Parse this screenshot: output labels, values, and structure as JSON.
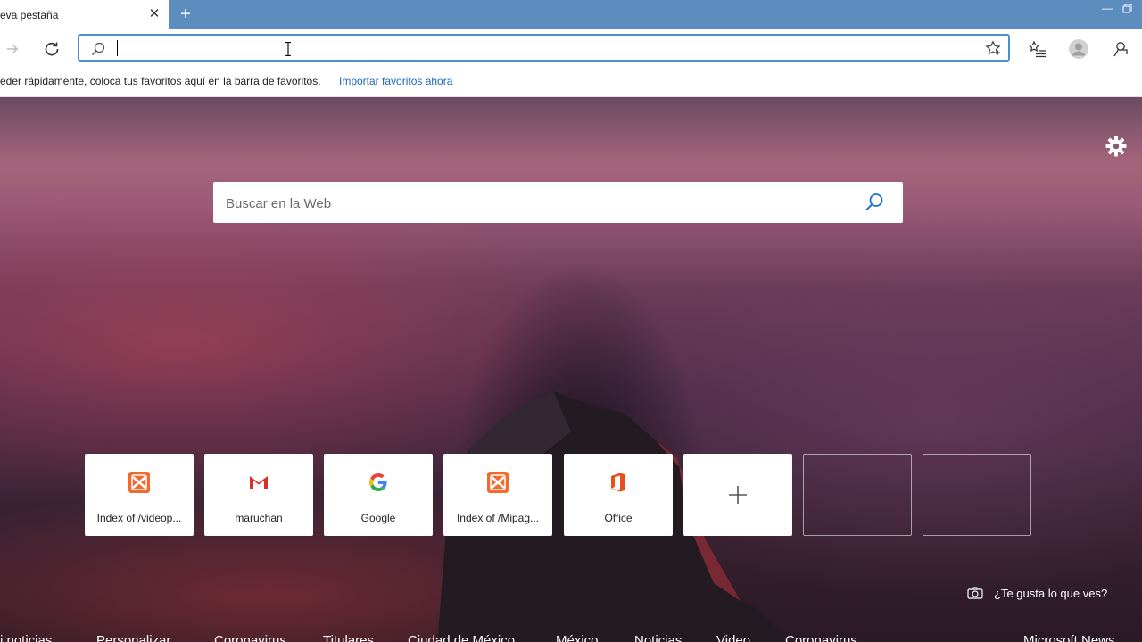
{
  "tab": {
    "title": "eva pestaña",
    "close": "✕",
    "new_tab": "+"
  },
  "window": {
    "minimize": "—"
  },
  "address_bar": {
    "value": "",
    "placeholder": ""
  },
  "favorites_bar": {
    "message": "eder rápidamente, coloca tus favoritos aquí en la barra de favoritos.",
    "link": "Importar favoritos ahora"
  },
  "search": {
    "placeholder": "Buscar en la Web"
  },
  "tiles": [
    {
      "label": "Index of /videop...",
      "icon": "xampp-icon",
      "color": "#f26b2c"
    },
    {
      "label": "maruchan",
      "icon": "gmail-icon",
      "color": "#d93025"
    },
    {
      "label": "Google",
      "icon": "google-icon",
      "color": "#4285f4"
    },
    {
      "label": "Index of /Mipag...",
      "icon": "xampp-icon",
      "color": "#f26b2c"
    },
    {
      "label": "Office",
      "icon": "office-icon",
      "color": "#e94e1b"
    },
    {
      "label": "+",
      "icon": "plus-icon",
      "color": "#555555"
    }
  ],
  "feedback": {
    "label": "¿Te gusta lo que ves?"
  },
  "bottom_nav": [
    "i noticias",
    "Personalizar",
    "Coronavirus",
    "Titulares",
    "Ciudad de México",
    "México",
    "Noticias",
    "Video",
    "Coronavirus",
    "Microsoft News"
  ],
  "colors": {
    "accent": "#4a8fd6",
    "tabstrip": "#5b8dbf",
    "link": "#1a66c2"
  }
}
